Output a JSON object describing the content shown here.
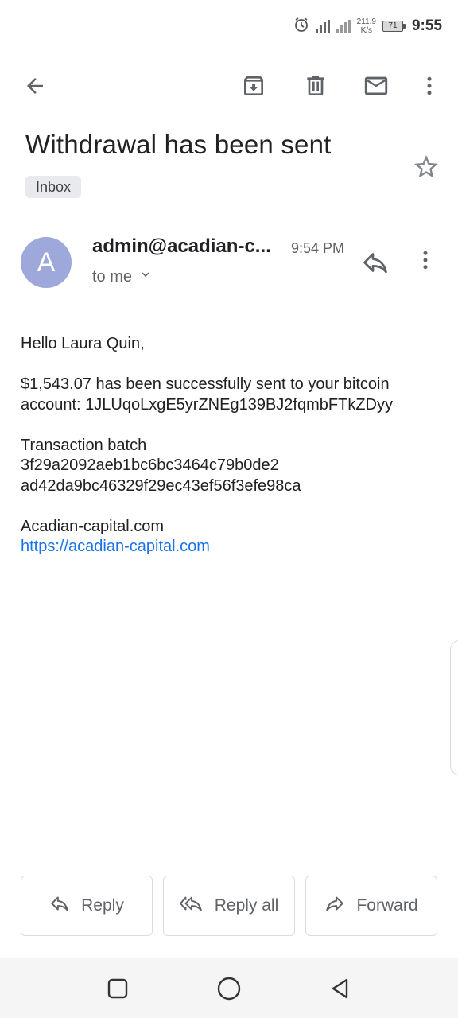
{
  "status_bar": {
    "net_speed_value": "211.9",
    "net_speed_unit": "K/s",
    "battery": "71",
    "time": "9:55"
  },
  "toolbar": {
    "icons": [
      "back-arrow-icon",
      "archive-icon",
      "delete-icon",
      "mark-unread-icon",
      "more-vert-icon"
    ]
  },
  "email": {
    "subject": "Withdrawal has been sent",
    "label": "Inbox",
    "sender_initial": "A",
    "sender": "admin@acadian-c...",
    "time": "9:54 PM",
    "recipient": "to me",
    "body": {
      "greeting": "Hello Laura Quin,",
      "sent_line1": "$1,543.07 has been successfully sent to your bitcoin",
      "sent_line2": "account: 1JLUqoLxgE5yrZNEg139BJ2fqmbFTkZDyy",
      "batch_label": "Transaction batch",
      "batch_hash1": "3f29a2092aeb1bc6bc3464c79b0de2",
      "batch_hash2": "ad42da9bc46329f29ec43ef56f3efe98ca",
      "signature_name": "Acadian-capital.com",
      "signature_link": "https://acadian-capital.com"
    }
  },
  "actions": {
    "reply": "Reply",
    "reply_all": "Reply all",
    "forward": "Forward"
  },
  "colors": {
    "avatar_bg": "#9fa8da",
    "link": "#1a73e8",
    "chip_bg": "#e8eaed"
  }
}
